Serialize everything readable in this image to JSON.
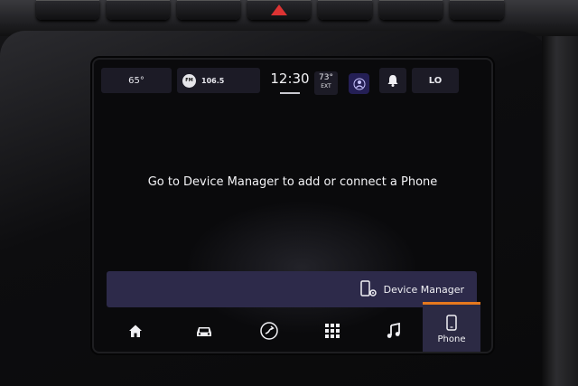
{
  "status_bar": {
    "temp_left": "65°",
    "radio_band": "FM",
    "radio_frequency": "106.5",
    "clock": "12:30",
    "exterior_temp": "73°",
    "exterior_label": "EXT",
    "fan_level": "LO"
  },
  "main": {
    "message": "Go to Device Manager to add or connect a Phone"
  },
  "device_manager": {
    "label": "Device Manager"
  },
  "nav": {
    "phone_label": "Phone",
    "active": "phone"
  },
  "colors": {
    "accent": "#e6781e",
    "bar": "#2d2a4a",
    "profile": "#241f55"
  }
}
